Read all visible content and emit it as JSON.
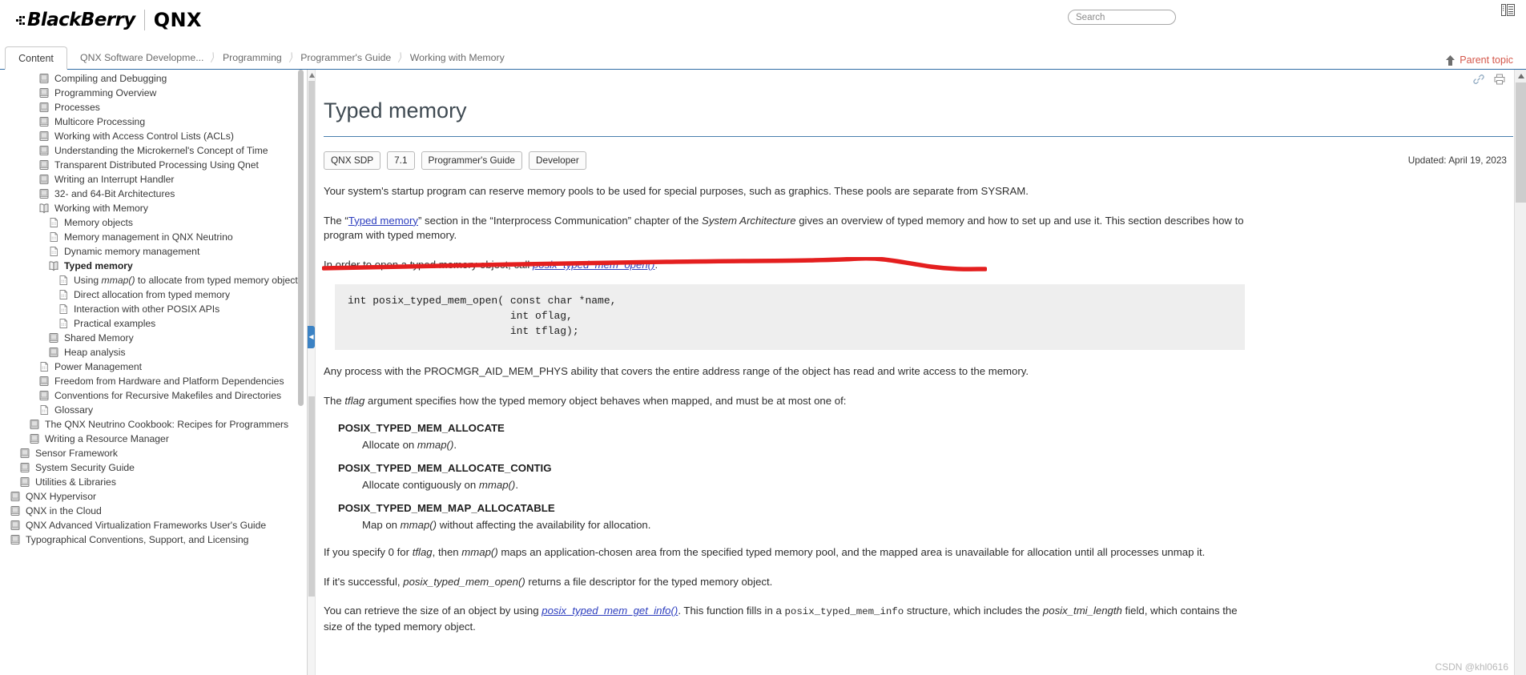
{
  "header": {
    "brand_primary": "BlackBerry",
    "brand_secondary": "QNX",
    "search_placeholder": "Search",
    "search_value": "",
    "layout_icon": "layout-panels-icon"
  },
  "breadcrumb": {
    "content_tab": "Content",
    "items": [
      "QNX Software Developme...",
      "Programming",
      "Programmer's Guide",
      "Working with Memory"
    ],
    "separator": "›",
    "parent_topic": "Parent topic",
    "parent_icon": "up-arrow-icon"
  },
  "sidebar": {
    "items": [
      {
        "label": "Compiling and Debugging",
        "icon": "book-icon",
        "indent": 1,
        "selected": false
      },
      {
        "label": "Programming Overview",
        "icon": "book-icon",
        "indent": 1,
        "selected": false
      },
      {
        "label": "Processes",
        "icon": "book-icon",
        "indent": 1,
        "selected": false
      },
      {
        "label": "Multicore Processing",
        "icon": "book-icon",
        "indent": 1,
        "selected": false
      },
      {
        "label": "Working with Access Control Lists (ACLs)",
        "icon": "book-icon",
        "indent": 1,
        "selected": false
      },
      {
        "label": "Understanding the Microkernel's Concept of Time",
        "icon": "book-icon",
        "indent": 1,
        "selected": false
      },
      {
        "label": "Transparent Distributed Processing Using Qnet",
        "icon": "book-icon",
        "indent": 1,
        "selected": false
      },
      {
        "label": "Writing an Interrupt Handler",
        "icon": "book-icon",
        "indent": 1,
        "selected": false
      },
      {
        "label": "32- and 64-Bit Architectures",
        "icon": "book-icon",
        "indent": 1,
        "selected": false
      },
      {
        "label": "Working with Memory",
        "icon": "open-book-icon",
        "indent": 1,
        "selected": false
      },
      {
        "label": "Memory objects",
        "icon": "page-icon",
        "indent": 2,
        "selected": false
      },
      {
        "label": "Memory management in QNX Neutrino",
        "icon": "page-icon",
        "indent": 2,
        "selected": false
      },
      {
        "label": "Dynamic memory management",
        "icon": "page-icon",
        "indent": 2,
        "selected": false
      },
      {
        "label": "Typed memory",
        "icon": "open-book-icon",
        "indent": 2,
        "selected": true
      },
      {
        "label": "Using mmap() to allocate from typed memory objects",
        "icon": "page-icon",
        "indent": 3,
        "selected": false,
        "italic_part": "mmap()"
      },
      {
        "label": "Direct allocation from typed memory",
        "icon": "page-icon",
        "indent": 3,
        "selected": false
      },
      {
        "label": "Interaction with other POSIX APIs",
        "icon": "page-icon",
        "indent": 3,
        "selected": false
      },
      {
        "label": "Practical examples",
        "icon": "page-icon",
        "indent": 3,
        "selected": false
      },
      {
        "label": "Shared Memory",
        "icon": "book-icon",
        "indent": 2,
        "selected": false
      },
      {
        "label": "Heap analysis",
        "icon": "book-icon",
        "indent": 2,
        "selected": false
      },
      {
        "label": "Power Management",
        "icon": "page-icon",
        "indent": 1,
        "selected": false
      },
      {
        "label": "Freedom from Hardware and Platform Dependencies",
        "icon": "book-icon",
        "indent": 1,
        "selected": false
      },
      {
        "label": "Conventions for Recursive Makefiles and Directories",
        "icon": "book-icon",
        "indent": 1,
        "selected": false
      },
      {
        "label": "Glossary",
        "icon": "page-icon",
        "indent": 1,
        "selected": false
      },
      {
        "label": "The QNX Neutrino Cookbook: Recipes for Programmers",
        "icon": "book-icon",
        "indent": 0,
        "selected": false
      },
      {
        "label": "Writing a Resource Manager",
        "icon": "book-icon",
        "indent": 0,
        "selected": false
      },
      {
        "label": "Sensor Framework",
        "icon": "book-icon",
        "indent": -1,
        "selected": false
      },
      {
        "label": "System Security Guide",
        "icon": "book-icon",
        "indent": -1,
        "selected": false
      },
      {
        "label": "Utilities & Libraries",
        "icon": "book-icon",
        "indent": -1,
        "selected": false
      },
      {
        "label": "QNX Hypervisor",
        "icon": "book-icon",
        "indent": -2,
        "selected": false
      },
      {
        "label": "QNX in the Cloud",
        "icon": "book-icon",
        "indent": -2,
        "selected": false
      },
      {
        "label": "QNX Advanced Virtualization Frameworks User's Guide",
        "icon": "book-icon",
        "indent": -2,
        "selected": false
      },
      {
        "label": "Typographical Conventions, Support, and Licensing",
        "icon": "book-icon",
        "indent": -2,
        "selected": false
      }
    ]
  },
  "document": {
    "title": "Typed memory",
    "badges": [
      "QNX SDP",
      "7.1",
      "Programmer's Guide",
      "Developer"
    ],
    "updated": "Updated: April 19, 2023",
    "tools": [
      "link-icon",
      "print-icon"
    ],
    "para1": "Your system's startup program can reserve memory pools to be used for special purposes, such as graphics. These pools are separate from SYSRAM.",
    "para2": {
      "before_link": "The “",
      "link": "Typed memory",
      "after_link": "” section in the “Interprocess Communication” chapter of the ",
      "italic": "System Architecture",
      "tail": " gives an overview of typed memory and how to set up and use it. This section describes how to program with typed memory."
    },
    "para3": {
      "before_link": "In order to open a typed memory object, call ",
      "link": "posix_typed_mem_open()",
      "after_link": ":"
    },
    "code": "int posix_typed_mem_open( const char *name,\n                          int oflag,\n                          int tflag);",
    "para4": "Any process with the PROCMGR_AID_MEM_PHYS ability that covers the entire address range of the object has read and write access to the memory.",
    "para5": {
      "before_italic": "The ",
      "italic": "tflag",
      "after_italic": " argument specifies how the typed memory object behaves when mapped, and must be at most one of:"
    },
    "definitions": [
      {
        "term": "POSIX_TYPED_MEM_ALLOCATE",
        "desc_before": "Allocate on ",
        "desc_italic": "mmap()",
        "desc_after": "."
      },
      {
        "term": "POSIX_TYPED_MEM_ALLOCATE_CONTIG",
        "desc_before": "Allocate contiguously on ",
        "desc_italic": "mmap()",
        "desc_after": "."
      },
      {
        "term": "POSIX_TYPED_MEM_MAP_ALLOCATABLE",
        "desc_before": "Map on ",
        "desc_italic": "mmap()",
        "desc_after": " without affecting the availability for allocation."
      }
    ],
    "para6": {
      "before": "If you specify 0 for ",
      "italic1": "tflag",
      "mid": ", then ",
      "italic2": "mmap()",
      "after": " maps an application-chosen area from the specified typed memory pool, and the mapped area is unavailable for allocation until all processes unmap it."
    },
    "para7": {
      "before": "If it's successful, ",
      "italic": "posix_typed_mem_open()",
      "after": " returns a file descriptor for the typed memory object."
    },
    "para8": {
      "before_link": "You can retrieve the size of an object by using ",
      "link": "posix_typed_mem_get_info()",
      "mid1": ". This function fills in a ",
      "mono1": "posix_typed_mem_info",
      "mid2": " structure, which includes the ",
      "italic1": "posix_tmi_length",
      "mid3": " field, which contains the size of the typed memory object."
    }
  },
  "annotation": {
    "type": "hand-drawn-underline",
    "color": "#e41f1f"
  },
  "watermark": "CSDN @khl0616",
  "colors": {
    "accent_blue": "#4a7fae",
    "link_blue": "#2c3dbe",
    "parent_topic_red": "#d4574a",
    "code_bg": "#eeeeee",
    "annotation_red": "#e41f1f"
  }
}
